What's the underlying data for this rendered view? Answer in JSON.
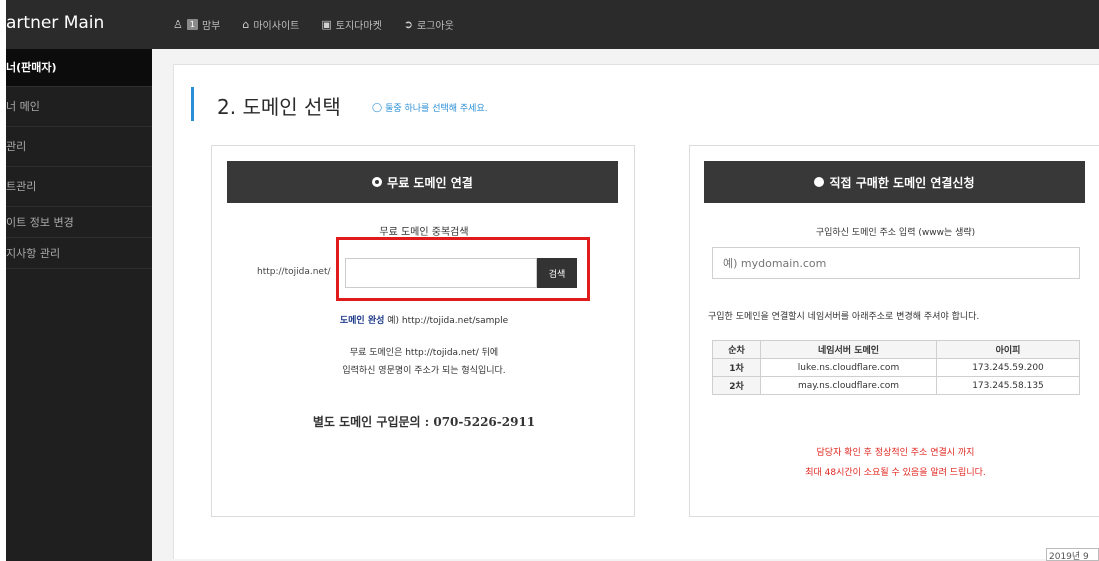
{
  "app": {
    "brand": "artner Main"
  },
  "topnav": {
    "user_badge": "1",
    "user_label": "맘부",
    "my_site": "마이사이트",
    "market": "토지다마켓",
    "logout": "로그아웃"
  },
  "sidebar": {
    "items": [
      {
        "label": "너(판매자)",
        "active": true
      },
      {
        "label": "너 메인"
      },
      {
        "label": "관리"
      },
      {
        "label": "트관리"
      },
      {
        "label": "이트 정보 변경"
      },
      {
        "label": "지사항 관리"
      }
    ]
  },
  "page": {
    "title": "2. 도메인 선택",
    "hint": "둘중 하나를 선택해 주세요."
  },
  "free_panel": {
    "header": "무료 도메인 연결",
    "search_caption": "무료 도메인 중복검색",
    "url_prefix": "http://tojida.net/",
    "input_value": "",
    "search_button": "검색",
    "complete_label": "도메인 완성",
    "complete_example": "예) http://tojida.net/sample",
    "desc_line1": "무료 도메인은 http://tojida.net/ 뒤에",
    "desc_line2": "입력하신 영문명이 주소가 되는 형식입니다.",
    "purchase_inquiry": "별도 도메인 구입문의 : 070-5226-2911"
  },
  "paid_panel": {
    "header": "직접 구매한 도메인 연결신청",
    "input_caption": "구입하신 도메인 주소 입력 (www는 생략)",
    "input_placeholder": "예) mydomain.com",
    "ns_notice": "구입한 도메인을 연결할시 네임서버를 아래주소로 변경해 주셔야 합니다.",
    "table": {
      "headers": [
        "순차",
        "네임서버 도메인",
        "아이피"
      ],
      "rows": [
        [
          "1차",
          "luke.ns.cloudflare.com",
          "173.245.59.200"
        ],
        [
          "2차",
          "may.ns.cloudflare.com",
          "173.245.58.135"
        ]
      ]
    },
    "note_line1": "담당자 확인 후 정상적인 주소 연결시 까지",
    "note_line2": "최대 48시간이 소요될 수 있음을 알려 드립니다."
  },
  "footer_stamp": "2019년 9",
  "colors": {
    "accent": "#2a8fd6",
    "highlight": "#e01b1b",
    "dark": "#383838",
    "warning": "#e0261f"
  }
}
